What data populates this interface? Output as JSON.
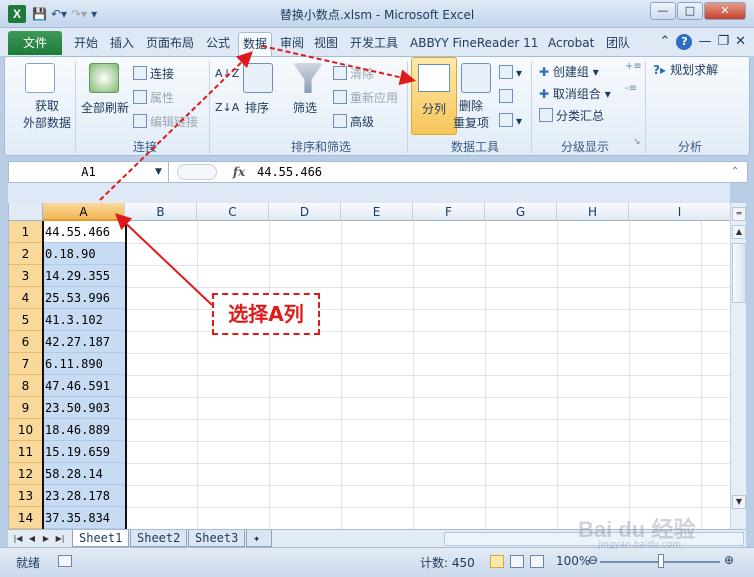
{
  "titlebar": {
    "logo": "X",
    "title": "替换小数点.xlsm - Microsoft Excel",
    "qat": [
      "save-icon",
      "undo-icon",
      "redo-icon",
      "customize-icon"
    ]
  },
  "tabs": {
    "file": "文件",
    "items": [
      "开始",
      "插入",
      "页面布局",
      "公式",
      "数据",
      "审阅",
      "视图",
      "开发工具",
      "ABBYY FineReader 11",
      "Acrobat",
      "团队"
    ],
    "active": "数据"
  },
  "ribbon": {
    "get_external_data": "获取\n外部数据",
    "get_external_line1": "获取",
    "get_external_line2": "外部数据",
    "refresh_all": "全部刷新",
    "connections": "连接",
    "properties": "属性",
    "edit_links": "编辑链接",
    "group_connections": "连接",
    "sort": "排序",
    "filter": "筛选",
    "clear": "清除",
    "reapply": "重新应用",
    "advanced": "高级",
    "group_sort_filter": "排序和筛选",
    "text_to_columns": "分列",
    "remove_dup_line1": "删除",
    "remove_dup_line2": "重复项",
    "group_data_tools": "数据工具",
    "group": "创建组",
    "ungroup": "取消组合",
    "subtotal": "分类汇总",
    "group_outline": "分级显示",
    "solver": "规划求解",
    "group_analysis": "分析"
  },
  "formula_bar": {
    "name_box": "A1",
    "fx": "fx",
    "value": "44.55.466"
  },
  "columns": [
    "A",
    "B",
    "C",
    "D",
    "E",
    "F",
    "G",
    "H",
    "I"
  ],
  "rows": [
    {
      "n": "1",
      "a": "44.55.466"
    },
    {
      "n": "2",
      "a": "0.18.90"
    },
    {
      "n": "3",
      "a": "14.29.355"
    },
    {
      "n": "4",
      "a": "25.53.996"
    },
    {
      "n": "5",
      "a": "41.3.102"
    },
    {
      "n": "6",
      "a": "42.27.187"
    },
    {
      "n": "7",
      "a": "6.11.890"
    },
    {
      "n": "8",
      "a": "47.46.591"
    },
    {
      "n": "9",
      "a": "23.50.903"
    },
    {
      "n": "10",
      "a": "18.46.889"
    },
    {
      "n": "11",
      "a": "15.19.659"
    },
    {
      "n": "12",
      "a": "58.28.14"
    },
    {
      "n": "13",
      "a": "23.28.178"
    },
    {
      "n": "14",
      "a": "37.35.834"
    }
  ],
  "sheet_tabs": [
    "Sheet1",
    "Sheet2",
    "Sheet3"
  ],
  "status": {
    "ready": "就绪",
    "count": "计数: 450",
    "zoom": "100%"
  },
  "annotation": {
    "callout": "选择A列",
    "color": "#e01a1a"
  },
  "watermark": {
    "main": "Bai du 经验",
    "sub": "jingyan.baidu.com"
  }
}
